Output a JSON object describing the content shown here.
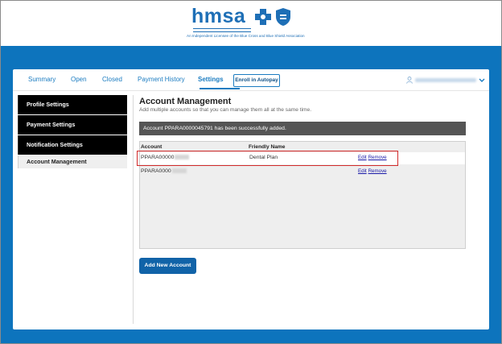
{
  "brand": {
    "wordmark": "hmsa",
    "tagline": "An Independent Licensee of the Blue Cross and Blue Shield Association",
    "color": "#1e6fb6"
  },
  "nav": {
    "tabs": [
      {
        "label": "Summary"
      },
      {
        "label": "Open"
      },
      {
        "label": "Closed"
      },
      {
        "label": "Payment History"
      },
      {
        "label": "Settings",
        "active": true
      }
    ],
    "autopay_label": "Enroll in Autopay"
  },
  "sidebar": {
    "items": [
      {
        "label": "Profile Settings"
      },
      {
        "label": "Payment Settings"
      },
      {
        "label": "Notification Settings"
      },
      {
        "label": "Account Management",
        "selected": true
      }
    ]
  },
  "main": {
    "title": "Account Management",
    "subtitle": "Add multiple accounts so that you can manage them all at the same time.",
    "alert": "Account PPARA0000045791 has been successfully added.",
    "table": {
      "headers": [
        "Account",
        "Friendly Name"
      ],
      "rows": [
        {
          "account": "PPARA00000",
          "friendly_name": "Dental Plan",
          "edit": "Edit",
          "remove": "Remove"
        },
        {
          "account": "PPARA0000",
          "friendly_name": "",
          "edit": "Edit",
          "remove": "Remove"
        }
      ]
    },
    "add_button": "Add New Account"
  },
  "colors": {
    "band": "#0d74bd",
    "link": "#1b7cc1",
    "highlight": "#d22a2a",
    "button": "#1163a8"
  }
}
